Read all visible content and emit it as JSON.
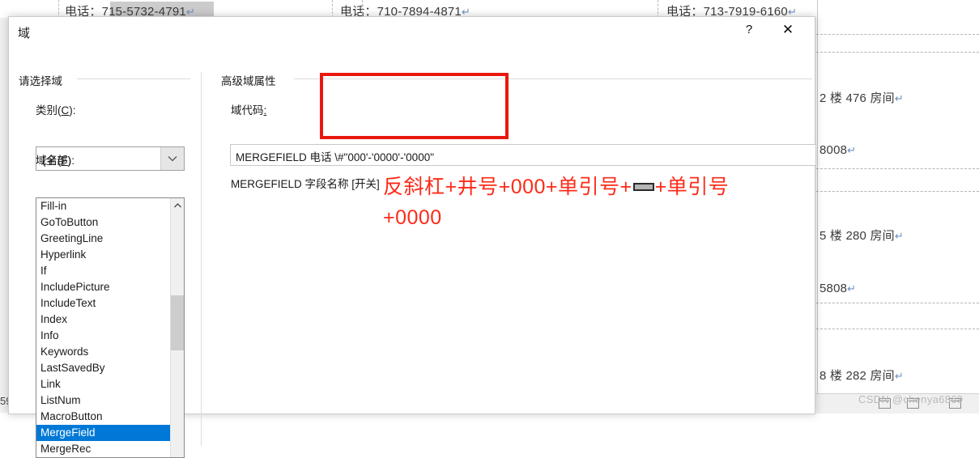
{
  "document_background": {
    "rows": [
      {
        "text": "电话：715-5732-4791",
        "pilcrow": "↵"
      },
      {
        "text": "电话：710-7894-4871",
        "pilcrow": "↵"
      },
      {
        "text": "电话：713-7919-6160",
        "pilcrow": "↵"
      }
    ],
    "right_column_lines": [
      {
        "text": "2 楼 476 房间",
        "pilcrow": "↵"
      },
      {
        "text": "8008",
        "pilcrow": "↵"
      },
      {
        "text": "5 楼 280 房间",
        "pilcrow": "↵"
      },
      {
        "text": "5808",
        "pilcrow": "↵"
      },
      {
        "text": "8 楼 282 房间",
        "pilcrow": "↵"
      }
    ],
    "status_bar": {
      "page_number": "59",
      "watermark": "CSDN @chenya6869"
    }
  },
  "dialog": {
    "title": "域",
    "titlebar_buttons": {
      "help": "?",
      "close": "✕"
    },
    "left_panel": {
      "group_label": "请选择域",
      "category_label_prefix": "类别(",
      "category_label_key": "C",
      "category_label_suffix": "):",
      "category_value": "(全部)",
      "field_name_label_prefix": "域名(",
      "field_name_label_key": "F",
      "field_name_label_suffix": "):",
      "field_list": [
        {
          "label": "Fill-in",
          "selected": false
        },
        {
          "label": "GoToButton",
          "selected": false
        },
        {
          "label": "GreetingLine",
          "selected": false
        },
        {
          "label": "Hyperlink",
          "selected": false
        },
        {
          "label": "If",
          "selected": false
        },
        {
          "label": "IncludePicture",
          "selected": false
        },
        {
          "label": "IncludeText",
          "selected": false
        },
        {
          "label": "Index",
          "selected": false
        },
        {
          "label": "Info",
          "selected": false
        },
        {
          "label": "Keywords",
          "selected": false
        },
        {
          "label": "LastSavedBy",
          "selected": false
        },
        {
          "label": "Link",
          "selected": false
        },
        {
          "label": "ListNum",
          "selected": false
        },
        {
          "label": "MacroButton",
          "selected": false
        },
        {
          "label": "MergeField",
          "selected": true
        },
        {
          "label": "MergeRec",
          "selected": false
        }
      ]
    },
    "right_panel": {
      "group_label": "高级域属性",
      "code_label_prefix": "域代码",
      "code_label_suffix": ":",
      "code_value": "MERGEFIELD  电话 \\#\"000'-'0000'-'0000\"",
      "code_hint": "MERGEFIELD 字段名称 [开关]"
    }
  },
  "annotation": {
    "color": "#fd2b19",
    "line1_part1": "反斜杠+井号+000+单引号+",
    "line1_part2": "+单引号",
    "line2": "+0000",
    "dash_glyph": "dash-key-icon"
  }
}
